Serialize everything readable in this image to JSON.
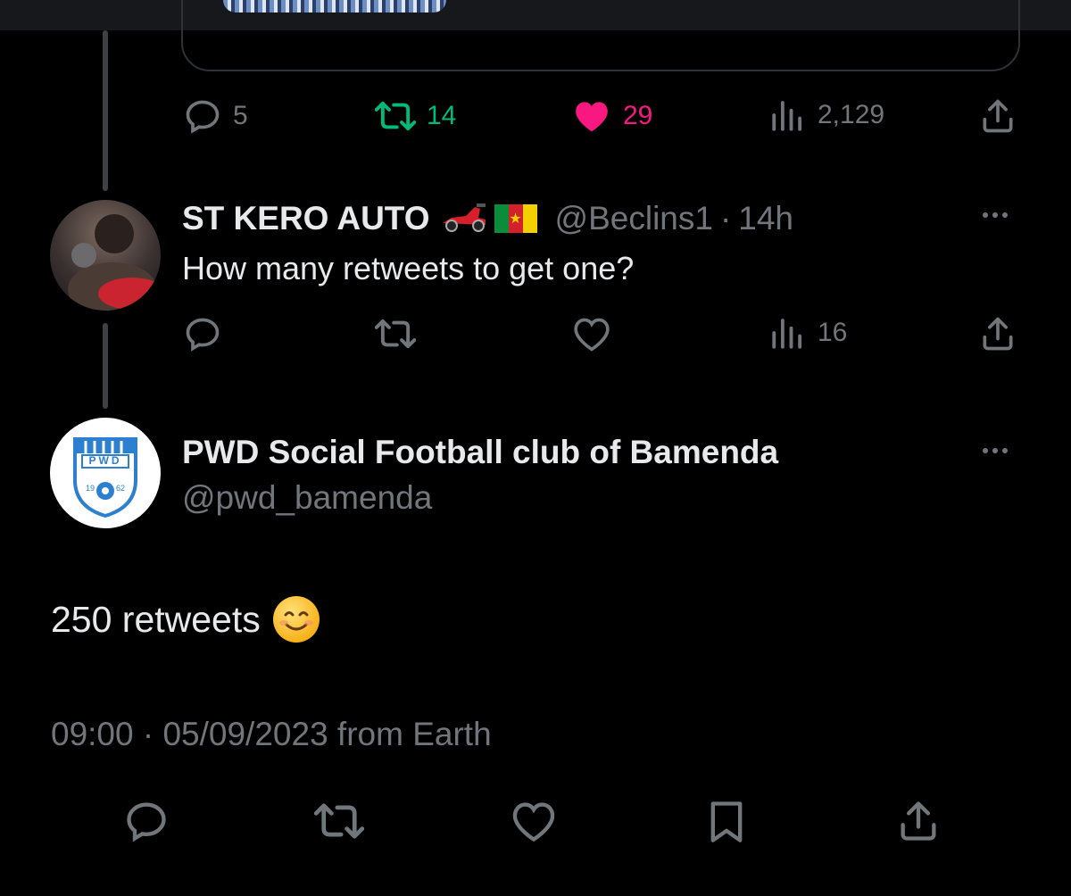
{
  "colors": {
    "background": "#000000",
    "text_primary": "#e7e9ea",
    "text_secondary": "#71767b",
    "retweet_green": "#00ba7c",
    "like_pink": "#f91880",
    "divider": "#2f3336"
  },
  "top_tweet": {
    "actions": {
      "replies": "5",
      "retweets": "14",
      "likes": "29",
      "views": "2,129"
    },
    "liked": true,
    "retweeted": true
  },
  "reply_tweet": {
    "name": "ST KERO AUTO",
    "name_emojis": [
      "racing-car",
      "cameroon-flag"
    ],
    "handle": "@Beclins1",
    "separator": "·",
    "time": "14h",
    "text": "How many retweets to get one?",
    "actions": {
      "views": "16"
    }
  },
  "main_tweet": {
    "name": "PWD Social Football club of Bamenda",
    "handle": "@pwd_bamenda",
    "avatar_logo_text": "PWD",
    "avatar_year_left": "19",
    "avatar_year_right": "62",
    "text": "250 retweets",
    "text_emoji": "smiling-face-with-smiling-eyes",
    "timestamp": "09:00 · 05/09/2023 from Earth"
  },
  "icons": [
    "reply-icon",
    "retweet-icon",
    "like-icon",
    "views-icon",
    "share-icon",
    "bookmark-icon",
    "more-icon"
  ]
}
